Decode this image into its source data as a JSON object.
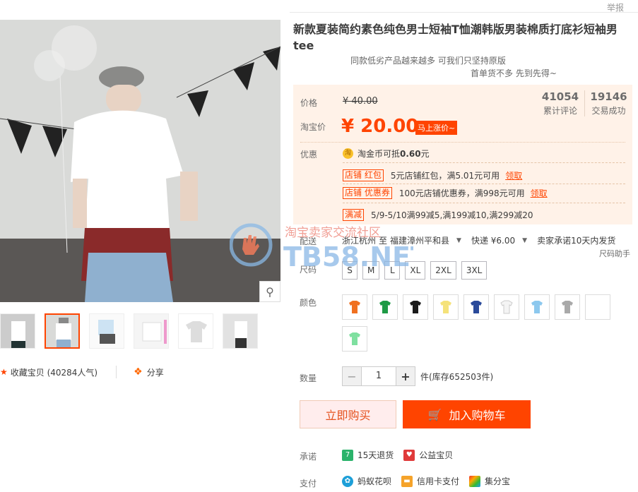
{
  "report_label": "举报",
  "product": {
    "title": "新款夏装简约素色纯色男士短袖T恤潮韩版男装棉质打底衫短袖男tee",
    "subtitle1": "同款低劣产品越来越多 可我们只坚持原版",
    "subtitle2": "首单货不多 先到先得~"
  },
  "price": {
    "orig_label": "价格",
    "orig_value": "¥ 40.00",
    "tb_label": "淘宝价",
    "tb_value": "¥ 20.00",
    "tag": "马上涨价~"
  },
  "stats": [
    {
      "num": "41054",
      "cap": "累计评论"
    },
    {
      "num": "19146",
      "cap": "交易成功"
    }
  ],
  "promo": {
    "label": "优惠",
    "coin_icon": "淘",
    "coin_text_a": "淘金币可抵",
    "coin_text_b": "0.60",
    "coin_text_c": "元",
    "items": [
      {
        "tag": "店铺 红包",
        "text": "5元店铺红包，满5.01元可用",
        "link": "领取"
      },
      {
        "tag": "店铺 优惠券",
        "text": "100元店铺优惠券，满998元可用",
        "link": "领取"
      },
      {
        "tag": "满减",
        "text": "5/9-5/10满99减5,满199减10,满299减20",
        "link": ""
      }
    ]
  },
  "shipping": {
    "label": "配送",
    "from": "浙江杭州",
    "to_word": "至",
    "to": "福建漳州平和县",
    "method": "快递 ¥6.00",
    "promise": "卖家承诺10天内发货",
    "size_helper": "尺码助手"
  },
  "size": {
    "label": "尺码",
    "options": [
      "S",
      "M",
      "L",
      "XL",
      "2XL",
      "3XL"
    ]
  },
  "color": {
    "label": "颜色",
    "swatches": [
      "#f07020",
      "#1e9a45",
      "#1a1a1a",
      "#f5e27a",
      "#2a4a9a",
      "#f4f4f4",
      "#8cc8ee",
      "#a9a9a9",
      "",
      "#7fe0a0"
    ]
  },
  "quantity": {
    "label": "数量",
    "minus": "−",
    "value": "1",
    "plus": "+",
    "stock": "件(库存652503件)"
  },
  "buttons": {
    "buy_now": "立即购买",
    "add_cart": "加入购物车"
  },
  "promise": {
    "label": "承诺",
    "items": [
      "15天退货",
      "公益宝贝"
    ]
  },
  "pay": {
    "label": "支付",
    "items": [
      "蚂蚁花呗",
      "信用卡支付",
      "集分宝"
    ]
  },
  "gallery": {
    "favorite": "收藏宝贝 (40284人气)",
    "share": "分享"
  },
  "watermark": {
    "line1": "淘宝卖家交流社区",
    "line2": "TB58.NET"
  }
}
